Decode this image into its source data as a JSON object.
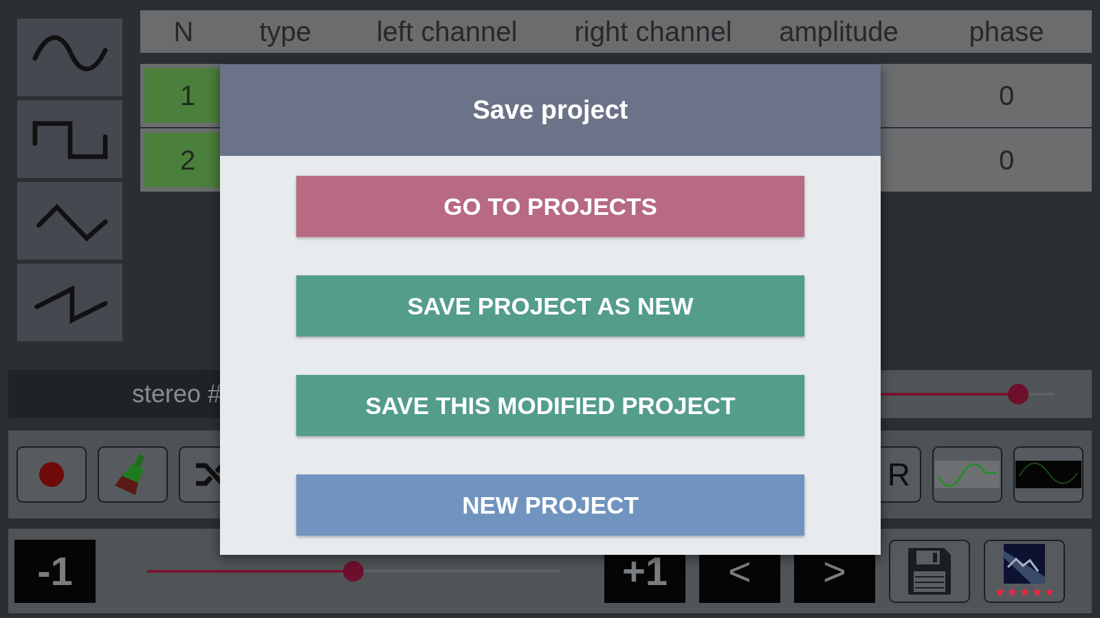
{
  "wave_buttons": [
    {
      "kind": "sine"
    },
    {
      "kind": "square"
    },
    {
      "kind": "triangle"
    },
    {
      "kind": "sawtooth"
    }
  ],
  "table": {
    "columns": [
      "N",
      "type",
      "left channel",
      "right channel",
      "amplitude",
      "phase"
    ],
    "rows": [
      {
        "n": "1",
        "phase": "0"
      },
      {
        "n": "2",
        "phase": "0"
      }
    ]
  },
  "stereo": {
    "label": "stereo #",
    "level": 0.955
  },
  "toolbar": {
    "left": [
      {
        "kind": "record"
      },
      {
        "kind": "brush"
      },
      {
        "kind": "swap"
      }
    ],
    "right": [
      {
        "kind": "text",
        "label": "R"
      },
      {
        "kind": "wave-light"
      },
      {
        "kind": "wave-dark"
      }
    ]
  },
  "bottom": {
    "minus": "-1",
    "level": 0.5,
    "plus": "+1",
    "prev": "<",
    "next": ">",
    "stars": 5
  },
  "dialog": {
    "title": "Save project",
    "buttons": [
      {
        "label": "GO TO PROJECTS",
        "color": "#b76a82"
      },
      {
        "label": "SAVE PROJECT AS NEW",
        "color": "#539d8a"
      },
      {
        "label": "SAVE THIS MODIFIED PROJECT",
        "color": "#539d8a"
      },
      {
        "label": "NEW PROJECT",
        "color": "#7094bf"
      }
    ]
  }
}
